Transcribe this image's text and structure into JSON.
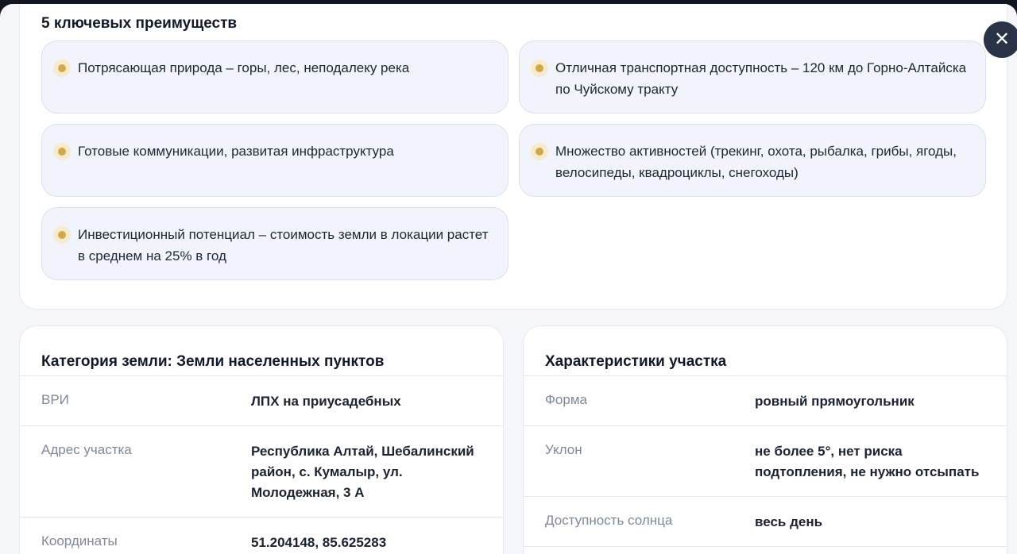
{
  "close": {
    "symbol": "✕"
  },
  "advantages": {
    "title": "5 ключевых преимуществ",
    "items": [
      "Потрясающая природа – горы, лес, неподалеку река",
      "Отличная транспортная доступность – 120 км до Горно-Алтайска по Чуйскому тракту",
      "Готовые коммуникации, развитая инфраструктура",
      "Множество активностей (трекинг, охота, рыбалка, грибы, ягоды, велосипеды, квадроциклы, снегоходы)",
      "Инвестиционный потенциал – стоимость земли в локации растет в среднем на 25% в год"
    ]
  },
  "land": {
    "title": "Категория земли: Земли населенных пунктов",
    "rows": [
      {
        "label": "ВРИ",
        "value": "ЛПХ на приусадебных"
      },
      {
        "label": "Адрес участка",
        "value": "Республика Алтай, Шебалинский район, с. Кумалыр, ул. Молодежная, 3 А"
      },
      {
        "label": "Координаты",
        "value": "51.204148, 85.625283"
      }
    ]
  },
  "plot": {
    "title": "Характеристики участка",
    "rows": [
      {
        "label": "Форма",
        "value": "ровный прямоугольник"
      },
      {
        "label": "Уклон",
        "value": "не более 5°, нет риска подтопления, не нужно отсыпать"
      },
      {
        "label": "Доступность солнца",
        "value": "весь день"
      }
    ]
  },
  "colors": {
    "accent_dot": "#d2a94a",
    "item_bg": "#f1f4fa",
    "close_bg": "#2a3346"
  }
}
